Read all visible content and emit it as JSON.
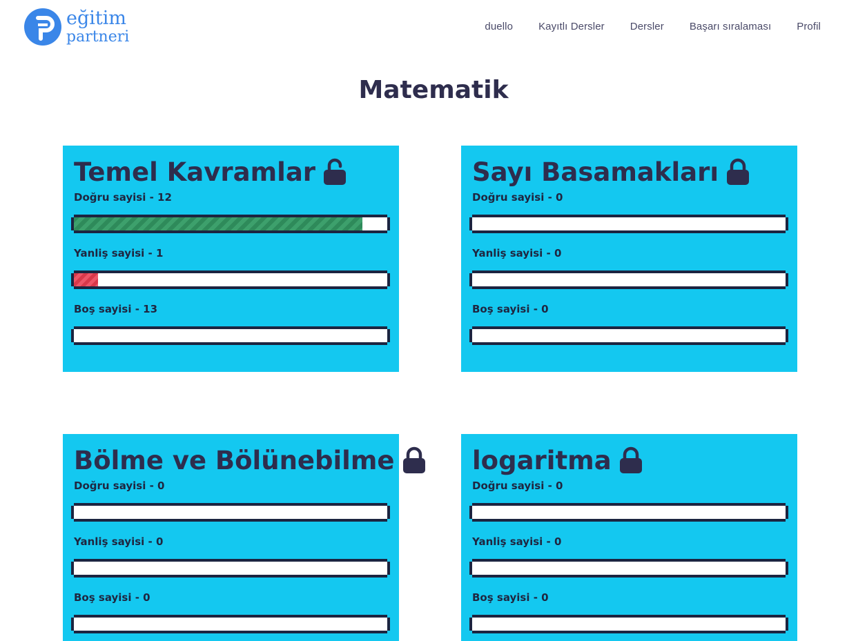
{
  "logo": {
    "line1": "eğitim",
    "line2": "partneri",
    "brand_color": "#3a86e8"
  },
  "nav": [
    "duello",
    "Kayıtlı Dersler",
    "Dersler",
    "Başarı sıralaması",
    "Profil"
  ],
  "page_title": "Matematik",
  "colors": {
    "card_bg": "#14c8f0",
    "correct": "#2e8a5a",
    "wrong": "#d9384a",
    "text": "#2e2d4d"
  },
  "cards": [
    {
      "title": "Temel Kavramlar",
      "lock_icon": "lock-open-icon",
      "stats": [
        {
          "label": "Doğru sayisi - 12",
          "fraction": 0.92,
          "kind": "green"
        },
        {
          "label": "Yanliş sayisi - 1",
          "fraction": 0.077,
          "kind": "red"
        },
        {
          "label": "Boş sayisi - 13",
          "fraction": 0,
          "kind": "none"
        }
      ]
    },
    {
      "title": "Sayı Basamakları",
      "lock_icon": "lock-closed-icon",
      "stats": [
        {
          "label": "Doğru sayisi - 0",
          "fraction": 0,
          "kind": "green"
        },
        {
          "label": "Yanliş sayisi - 0",
          "fraction": 0,
          "kind": "red"
        },
        {
          "label": "Boş sayisi - 0",
          "fraction": 0,
          "kind": "none"
        }
      ]
    },
    {
      "title": "Bölme ve Bölünebilme",
      "lock_icon": "lock-closed-icon",
      "stats": [
        {
          "label": "Doğru sayisi - 0",
          "fraction": 0,
          "kind": "green"
        },
        {
          "label": "Yanliş sayisi - 0",
          "fraction": 0,
          "kind": "red"
        },
        {
          "label": "Boş sayisi - 0",
          "fraction": 0,
          "kind": "none"
        }
      ]
    },
    {
      "title": "logaritma",
      "lock_icon": "lock-closed-icon",
      "stats": [
        {
          "label": "Doğru sayisi - 0",
          "fraction": 0,
          "kind": "green"
        },
        {
          "label": "Yanliş sayisi - 0",
          "fraction": 0,
          "kind": "red"
        },
        {
          "label": "Boş sayisi - 0",
          "fraction": 0,
          "kind": "none"
        }
      ]
    }
  ]
}
